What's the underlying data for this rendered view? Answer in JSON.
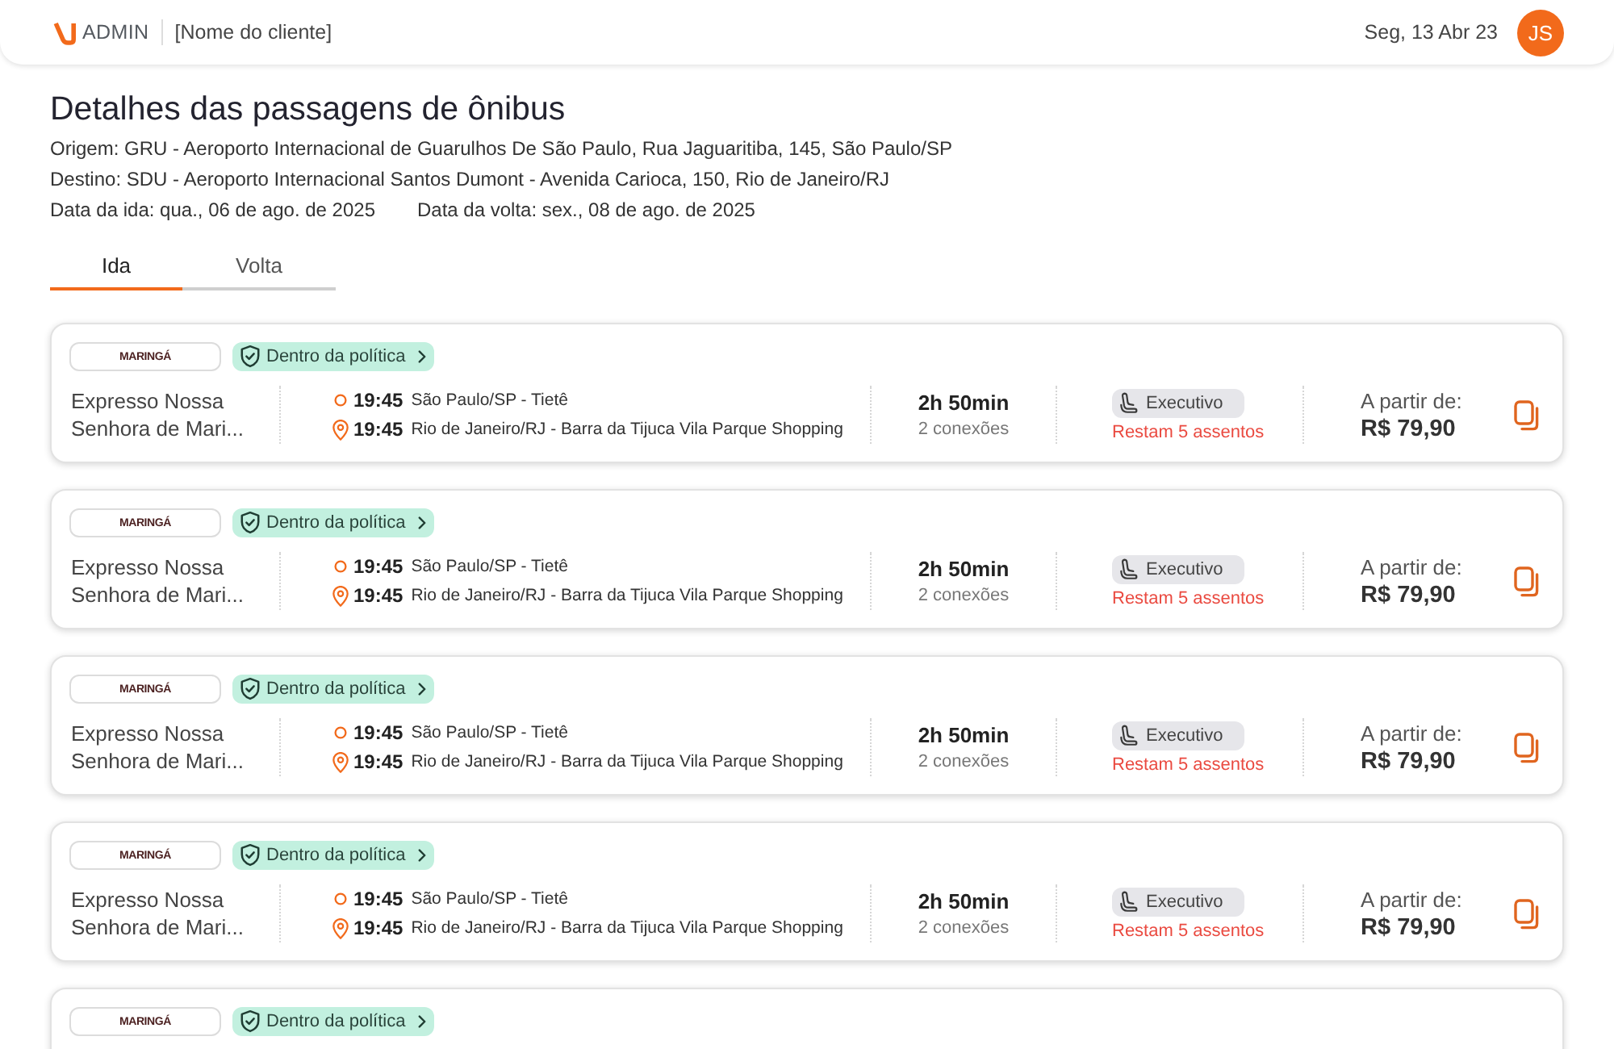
{
  "header": {
    "brand": "ADMIN",
    "client": "[Nome do cliente]",
    "date": "Seg, 13 Abr 23",
    "avatar_initials": "JS"
  },
  "page": {
    "title": "Detalhes das passagens de ônibus",
    "origin": "Origem: GRU - Aeroporto Internacional de Guarulhos De São Paulo, Rua Jaguaritiba, 145, São Paulo/SP",
    "destination": "Destino: SDU - Aeroporto Internacional Santos Dumont - Avenida Carioca, 150, Rio de Janeiro/RJ",
    "departure_date": "Data da ida: qua., 06 de ago. de 2025",
    "return_date": "Data da volta: sex., 08 de ago. de 2025"
  },
  "tabs": [
    {
      "label": "Ida",
      "selected": true
    },
    {
      "label": "Volta",
      "selected": false
    }
  ],
  "trips": [
    {
      "carrier_logo": "MARINGÁ",
      "policy": "Dentro da política",
      "company": "Expresso Nossa Senhora de Mari...",
      "legs": [
        {
          "kind": "origin",
          "time": "19:45",
          "place": "São Paulo/SP - Tietê"
        },
        {
          "kind": "destination",
          "time": "19:45",
          "place": "Rio de Janeiro/RJ - Barra da Tijuca Vila Parque Shopping"
        }
      ],
      "duration": "2h 50min",
      "connections": "2 conexões",
      "seat_class": "Executivo",
      "seats_left": "Restam 5 assentos",
      "price_caption": "A partir de:",
      "price": "R$ 79,90"
    },
    {
      "carrier_logo": "MARINGÁ",
      "policy": "Dentro da política",
      "company": "Expresso Nossa Senhora de Mari...",
      "legs": [
        {
          "kind": "origin",
          "time": "19:45",
          "place": "São Paulo/SP - Tietê"
        },
        {
          "kind": "destination",
          "time": "19:45",
          "place": "Rio de Janeiro/RJ - Barra da Tijuca Vila Parque Shopping"
        }
      ],
      "duration": "2h 50min",
      "connections": "2 conexões",
      "seat_class": "Executivo",
      "seats_left": "Restam 5 assentos",
      "price_caption": "A partir de:",
      "price": "R$ 79,90"
    },
    {
      "carrier_logo": "MARINGÁ",
      "policy": "Dentro da política",
      "company": "Expresso Nossa Senhora de Mari...",
      "legs": [
        {
          "kind": "origin",
          "time": "19:45",
          "place": "São Paulo/SP - Tietê"
        },
        {
          "kind": "destination",
          "time": "19:45",
          "place": "Rio de Janeiro/RJ - Barra da Tijuca Vila Parque Shopping"
        }
      ],
      "duration": "2h 50min",
      "connections": "2 conexões",
      "seat_class": "Executivo",
      "seats_left": "Restam 5 assentos",
      "price_caption": "A partir de:",
      "price": "R$ 79,90"
    },
    {
      "carrier_logo": "MARINGÁ",
      "policy": "Dentro da política",
      "company": "Expresso Nossa Senhora de Mari...",
      "legs": [
        {
          "kind": "origin",
          "time": "19:45",
          "place": "São Paulo/SP - Tietê"
        },
        {
          "kind": "destination",
          "time": "19:45",
          "place": "Rio de Janeiro/RJ - Barra da Tijuca Vila Parque Shopping"
        }
      ],
      "duration": "2h 50min",
      "connections": "2 conexões",
      "seat_class": "Executivo",
      "seats_left": "Restam 5 assentos",
      "price_caption": "A partir de:",
      "price": "R$ 79,90"
    },
    {
      "carrier_logo": "MARINGÁ",
      "policy": "Dentro da política"
    }
  ]
}
